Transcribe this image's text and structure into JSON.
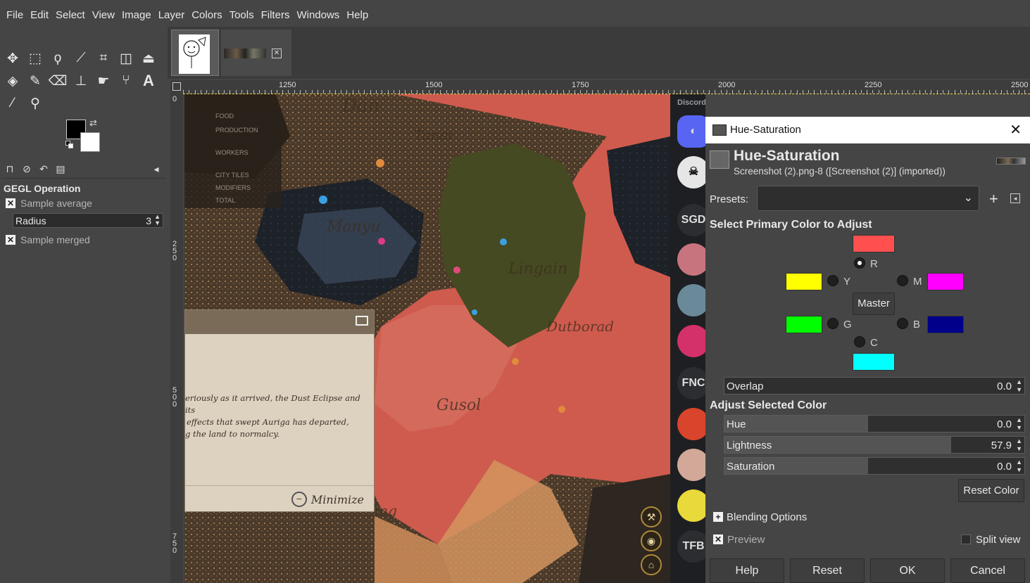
{
  "menu": [
    "File",
    "Edit",
    "Select",
    "View",
    "Image",
    "Layer",
    "Colors",
    "Tools",
    "Filters",
    "Windows",
    "Help"
  ],
  "tool_options": {
    "title": "GEGL Operation",
    "sample_average": "Sample average",
    "radius_label": "Radius",
    "radius_value": "3",
    "sample_merged": "Sample merged"
  },
  "ruler": {
    "h_labels": [
      "1250",
      "1500",
      "1750",
      "2000",
      "2250",
      "2500"
    ],
    "v_labels": [
      "0",
      "250",
      "500",
      "750"
    ]
  },
  "canvas": {
    "map_labels": [
      "Dan",
      "Tanai",
      "Manyu",
      "Lingain",
      "Dutborad",
      "Gusol",
      "ing"
    ],
    "legend": [
      "FOOD",
      "PRODUCTION",
      "WORKERS",
      "CITY TILES",
      "MODIFIERS",
      "TOTAL"
    ],
    "popup_text": [
      "eriously as it arrived, the Dust Eclipse and its",
      "effects that swept Auriga has departed,",
      "g the land to normalcy."
    ],
    "minimize_label": "Minimize"
  },
  "discord": {
    "title": "Discord",
    "servers": [
      "SGD",
      "FNC",
      "TFB"
    ]
  },
  "dialog": {
    "window_title": "Hue-Saturation",
    "heading": "Hue-Saturation",
    "subtitle": "Screenshot (2).png-8 ([Screenshot (2)] (imported))",
    "presets_label": "Presets:",
    "presets_value": "",
    "select_primary_title": "Select Primary Color to Adjust",
    "primaries": {
      "R": {
        "label": "R",
        "color": "#ff4f4f"
      },
      "Y": {
        "label": "Y",
        "color": "#ffff00"
      },
      "M": {
        "label": "M",
        "color": "#ff00ff"
      },
      "G": {
        "label": "G",
        "color": "#00ff00"
      },
      "B": {
        "label": "B",
        "color": "#00008b"
      },
      "C": {
        "label": "C",
        "color": "#00ffff"
      }
    },
    "selected_primary": "R",
    "master_label": "Master",
    "overlap_label": "Overlap",
    "overlap_value": "0.0",
    "adjust_title": "Adjust Selected Color",
    "hue_label": "Hue",
    "hue_value": "0.0",
    "hue_fill": 0.48,
    "lightness_label": "Lightness",
    "lightness_value": "57.9",
    "lightness_fill": 0.755,
    "saturation_label": "Saturation",
    "saturation_value": "0.0",
    "saturation_fill": 0.48,
    "reset_color_label": "Reset Color",
    "blending_options_label": "Blending Options",
    "preview_label": "Preview",
    "preview_checked": true,
    "split_view_label": "Split view",
    "split_view_checked": false,
    "buttons": {
      "help": "Help",
      "reset": "Reset",
      "ok": "OK",
      "cancel": "Cancel"
    }
  }
}
